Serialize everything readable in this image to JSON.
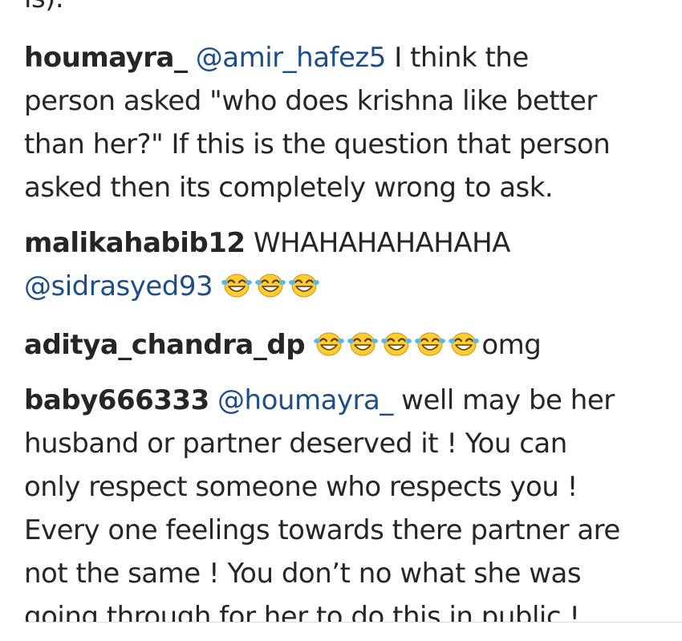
{
  "comments": [
    {
      "prev_fragment": "is).",
      "username": "houmayra_",
      "mention": "@amir_hafez5",
      "lines": [
        "I think the",
        "person asked \"who does krishna like better",
        "than her?\" If this is the question that person",
        "asked then its completely wrong to ask."
      ]
    },
    {
      "username": "malikahabib12",
      "text": "WHAHAHAHAHAHA",
      "mention": "@sidrasyed93",
      "emoji": "face-with-tears-of-joy-icon",
      "emoji_count": 3
    },
    {
      "username": "aditya_chandra_dp",
      "emoji": "face-with-tears-of-joy-icon",
      "emoji_count": 5,
      "text": "omg"
    },
    {
      "username": "baby666333",
      "mention": "@houmayra_",
      "lines": [
        "well may be her",
        "husband or partner deserved it ! You can",
        "only respect someone who respects you !",
        "Every one feelings towards there partner are",
        "not the same ! You don’t no what she was",
        "going through for her to do this in public !"
      ]
    }
  ],
  "colors": {
    "text": "#262626",
    "mention": "#1d4e89",
    "emoji_face": "#ffcc33"
  }
}
